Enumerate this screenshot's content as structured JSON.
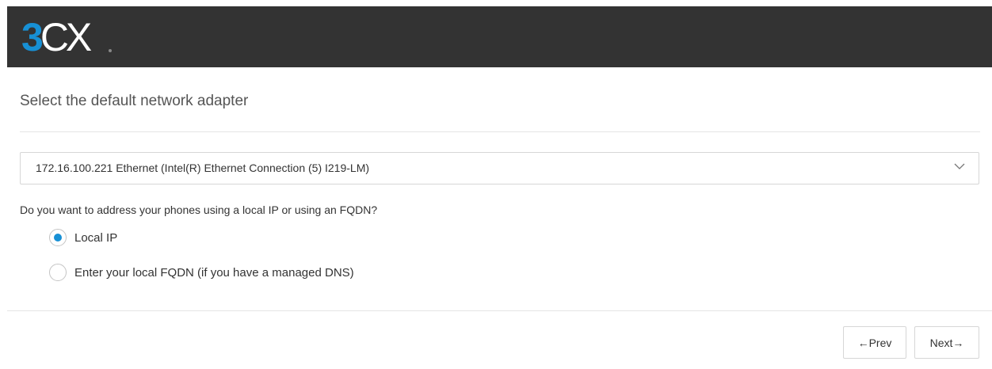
{
  "header": {
    "logo_3": "3",
    "logo_cx": "CX",
    "logo_icon": "3cx-logo"
  },
  "page": {
    "title": "Select the default network adapter"
  },
  "adapter_select": {
    "selected_value": "172.16.100.221 Ethernet (Intel(R) Ethernet Connection (5) I219-LM)",
    "icon": "chevron-down-icon"
  },
  "address_question": {
    "label": "Do you want to address your phones using a local IP or using an FQDN?",
    "options": [
      {
        "label": "Local IP",
        "selected": true
      },
      {
        "label": "Enter your local FQDN (if you have a managed DNS)",
        "selected": false
      }
    ]
  },
  "footer": {
    "prev_label": "←Prev",
    "next_label": "Next→"
  },
  "colors": {
    "header_bg": "#333333",
    "accent": "#1790d5"
  }
}
